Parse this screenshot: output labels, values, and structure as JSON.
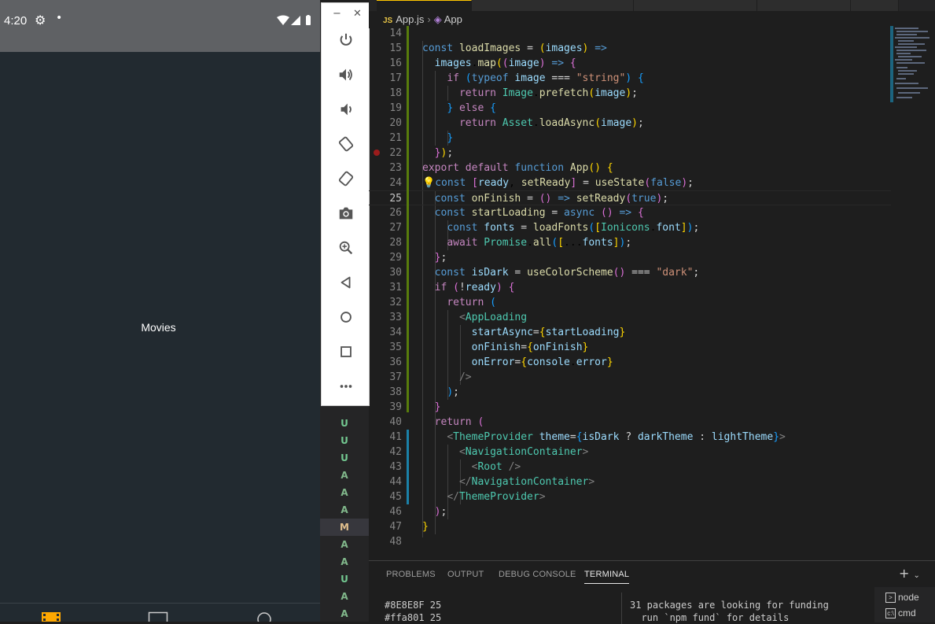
{
  "phone": {
    "status_time": "4:20",
    "center_label": "Movies",
    "tabs": [
      {
        "icon": "film-icon",
        "active": true
      },
      {
        "icon": "tv-icon",
        "active": false
      },
      {
        "icon": "search-icon",
        "active": false
      }
    ]
  },
  "emulator_toolbar": {
    "minimize": "−",
    "close": "✕",
    "buttons": [
      "power-icon",
      "volume-up-icon",
      "volume-down-icon",
      "rotate-left-icon",
      "rotate-right-icon",
      "camera-icon",
      "zoom-icon",
      "back-icon",
      "home-icon",
      "overview-icon",
      "more-icon"
    ]
  },
  "scm_letters": [
    "U",
    "U",
    "U",
    "A",
    "A",
    "A",
    "M",
    "A",
    "A",
    "U",
    "A",
    "A"
  ],
  "scm_colors": {
    "U": "#73c991",
    "A": "#81b88b",
    "M": "#e2c08d"
  },
  "editor": {
    "breadcrumb": {
      "file": "App.js",
      "symbol": "App",
      "file_icon": "JS"
    },
    "active_line": 25,
    "line_numbers": [
      "14",
      "15",
      "16",
      "17",
      "18",
      "19",
      "20",
      "21",
      "22",
      "23",
      "24",
      "25",
      "26",
      "27",
      "28",
      "29",
      "30",
      "31",
      "32",
      "33",
      "34",
      "35",
      "36",
      "37",
      "38",
      "39",
      "40",
      "41",
      "42",
      "43",
      "44",
      "45",
      "46",
      "47",
      "48"
    ]
  },
  "panel": {
    "tabs": [
      "PROBLEMS",
      "OUTPUT",
      "DEBUG CONSOLE",
      "TERMINAL"
    ],
    "active_tab": "TERMINAL",
    "terminal_left": [
      "#8E8E8F 25",
      "#ffa801 25"
    ],
    "terminal_right": [
      "31 packages are looking for funding",
      "  run `npm fund` for details"
    ],
    "terminals": [
      "node",
      "cmd"
    ],
    "add_terminal": "+"
  },
  "colors": {
    "editor_bg": "#1e1e1e",
    "phone_bg": "#222a30",
    "status_bar": "#5f6164",
    "accent_tab": "#ffc600"
  }
}
